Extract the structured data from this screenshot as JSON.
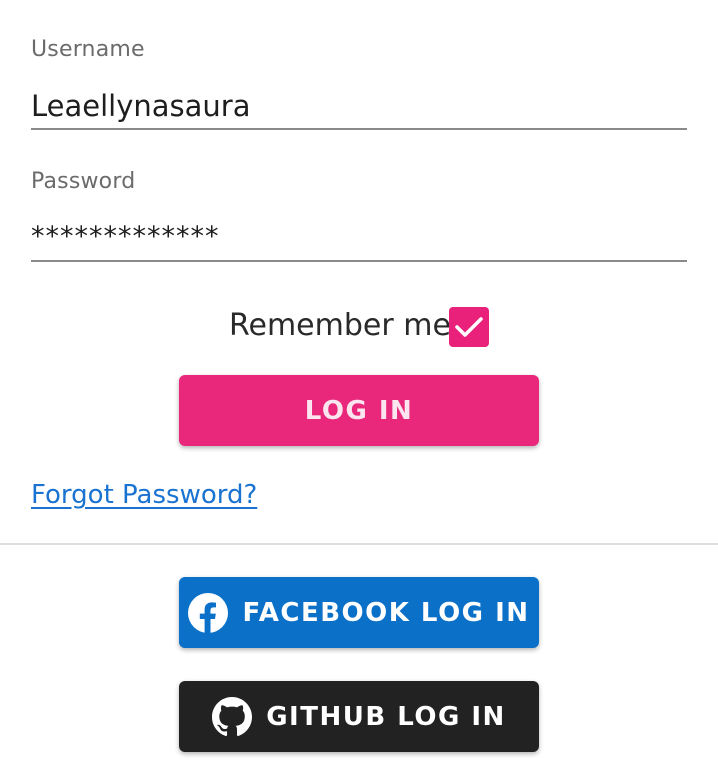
{
  "username": {
    "label": "Username",
    "value": "Leaellynasaura"
  },
  "password": {
    "label": "Password",
    "value": "*************"
  },
  "remember": {
    "label": "Remember me",
    "checked": true
  },
  "login_button": {
    "label": "LOG IN",
    "color": "#e9287c"
  },
  "forgot_link": {
    "label": "Forgot Password?"
  },
  "facebook_button": {
    "label": "FACEBOOK LOG IN",
    "icon": "facebook-icon",
    "color": "#0b70c8"
  },
  "github_button": {
    "label": "GITHUB LOG IN",
    "icon": "github-icon",
    "color": "#222222"
  },
  "accent_color": "#e9217a"
}
